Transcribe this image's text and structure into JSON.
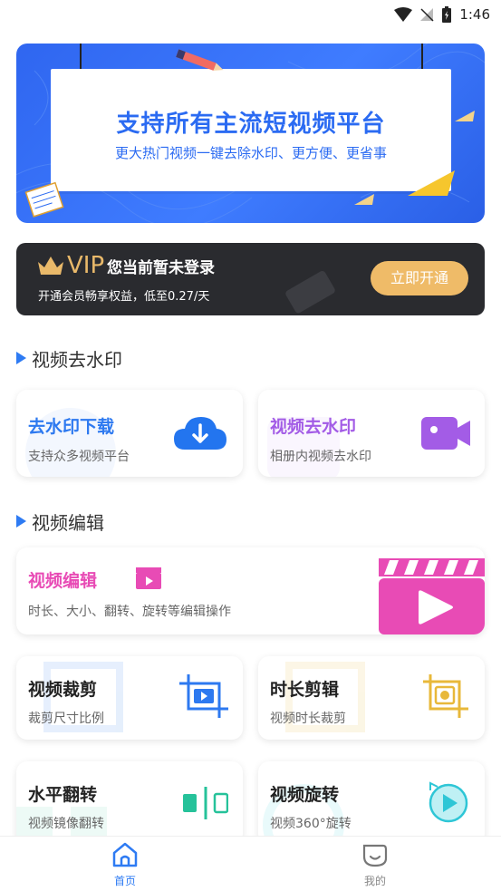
{
  "status_bar": {
    "time": "1:46"
  },
  "banner": {
    "title": "支持所有主流短视频平台",
    "subtitle": "更大热门视频一键去除水印、更方便、更省事"
  },
  "vip": {
    "badge": "VIP",
    "login_status": "您当前暂未登录",
    "description": "开通会员畅享权益，低至0.27/天",
    "button": "立即开通"
  },
  "sections": {
    "watermark": {
      "title": "视频去水印"
    },
    "edit": {
      "title": "视频编辑"
    }
  },
  "cards": {
    "download": {
      "title": "去水印下载",
      "desc": "支持众多视频平台",
      "color": "#2d79f0"
    },
    "album": {
      "title": "视频去水印",
      "desc": "相册内视频去水印",
      "color": "#a35ce6"
    },
    "edit": {
      "title": "视频编辑",
      "desc": "时长、大小、翻转、旋转等编辑操作",
      "color": "#e84bb5"
    },
    "crop": {
      "title": "视频裁剪",
      "desc": "裁剪尺寸比例",
      "color": "#2d79f0"
    },
    "trim": {
      "title": "时长剪辑",
      "desc": "视频时长裁剪",
      "color": "#e8b83a"
    },
    "flip": {
      "title": "水平翻转",
      "desc": "视频镜像翻转",
      "color": "#26c29a"
    },
    "rotate": {
      "title": "视频旋转",
      "desc": "视频360°旋转",
      "color": "#2ec6d6"
    }
  },
  "bottom_nav": {
    "home": {
      "label": "首页",
      "icon": "home-icon",
      "active": true
    },
    "mine": {
      "label": "我的",
      "icon": "smile-face-icon",
      "active": false
    }
  },
  "colors": {
    "accent": "#2e7bf3",
    "vip_gold": "#efbb68",
    "vip_bg": "#2a2b2f"
  }
}
